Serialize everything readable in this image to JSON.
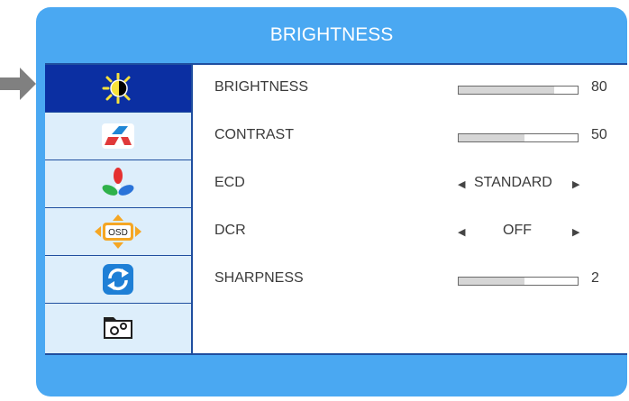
{
  "header": {
    "title": "BRIGHTNESS"
  },
  "sidebar": {
    "items": [
      {
        "icon": "brightness-contrast-icon",
        "active": true
      },
      {
        "icon": "image-shape-icon",
        "active": false
      },
      {
        "icon": "color-icon",
        "active": false
      },
      {
        "icon": "osd-icon",
        "active": false,
        "badge": "OSD"
      },
      {
        "icon": "reset-icon",
        "active": false
      },
      {
        "icon": "settings-gear-icon",
        "active": false
      }
    ]
  },
  "settings": [
    {
      "label": "BRIGHTNESS",
      "type": "slider",
      "value": 80,
      "fill": 0.8
    },
    {
      "label": "CONTRAST",
      "type": "slider",
      "value": 50,
      "fill": 0.55
    },
    {
      "label": "ECD",
      "type": "choice",
      "value": "STANDARD"
    },
    {
      "label": "DCR",
      "type": "choice",
      "value": "OFF"
    },
    {
      "label": "SHARPNESS",
      "type": "slider",
      "value": 2,
      "fill": 0.55
    }
  ],
  "colors": {
    "panel": "#4aa8f2",
    "dark_blue": "#0b2fa2",
    "sidebar": "#ddeefb",
    "pointer": "#808080"
  }
}
